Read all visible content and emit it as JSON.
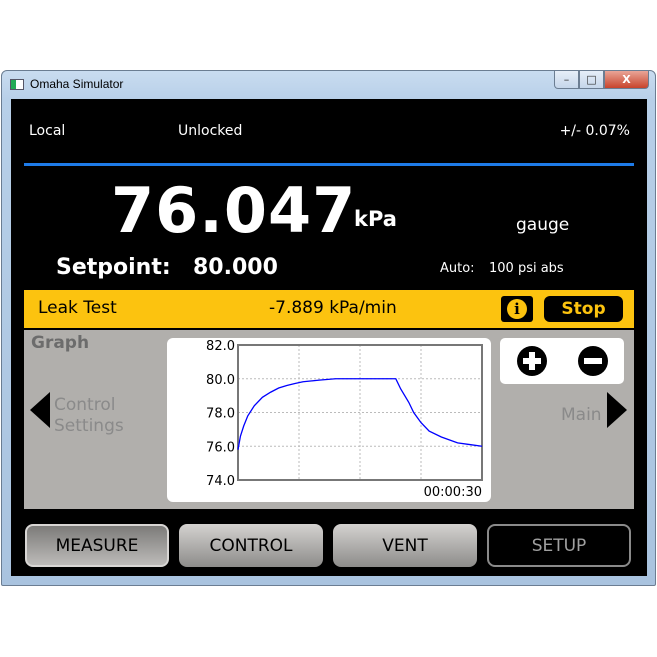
{
  "window": {
    "title": "Omaha Simulator",
    "minimize": "–",
    "maximize": "□",
    "close": "X"
  },
  "status": {
    "mode": "Local",
    "lock": "Unlocked",
    "accuracy": "+/- 0.07%"
  },
  "reading": {
    "value": "76.047",
    "unit": "kPa",
    "type": "gauge",
    "setpoint_label": "Setpoint:",
    "setpoint_value": "80.000",
    "range_label": "Auto:",
    "range_value": "100 psi abs"
  },
  "leak_test": {
    "label": "Leak Test",
    "rate": "-7.889 kPa/min",
    "info": "i",
    "stop": "Stop"
  },
  "panel": {
    "title": "Graph",
    "left_nav": [
      "Control",
      "Settings"
    ],
    "right_nav": "Main"
  },
  "chart_data": {
    "type": "line",
    "ylim": [
      74,
      82
    ],
    "xlim": [
      0,
      30
    ],
    "yticks": [
      "82.0",
      "80.0",
      "78.0",
      "76.0",
      "74.0"
    ],
    "xlabel_time": "00:00:30",
    "grid": true,
    "color": "#0000ff",
    "x": [
      0,
      0.3,
      0.7,
      1.2,
      2,
      3,
      4,
      5,
      6,
      7,
      8,
      10,
      12,
      15,
      19,
      19.4,
      20,
      21,
      21.6,
      22.5,
      23.5,
      25,
      27,
      28.5,
      30
    ],
    "y": [
      75.8,
      76.6,
      77.2,
      77.8,
      78.4,
      78.9,
      79.2,
      79.45,
      79.6,
      79.72,
      79.82,
      79.92,
      80,
      80,
      80,
      80,
      79.4,
      78.6,
      78.0,
      77.4,
      76.9,
      76.55,
      76.2,
      76.1,
      76.0
    ]
  },
  "buttons": {
    "measure": "MEASURE",
    "control": "CONTROL",
    "vent": "VENT",
    "setup": "SETUP"
  }
}
